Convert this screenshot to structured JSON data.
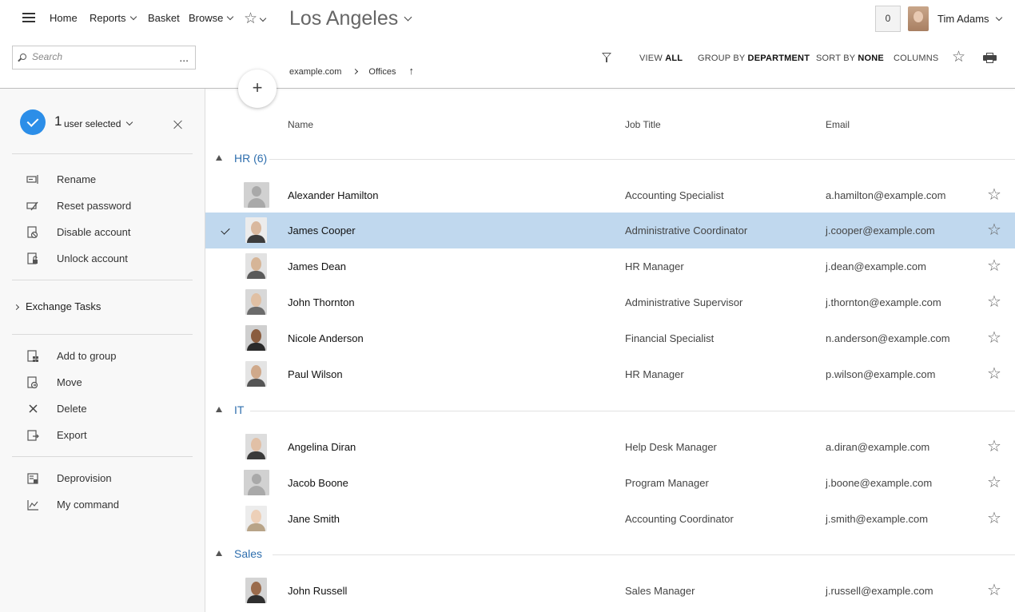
{
  "nav": {
    "items": [
      {
        "label": "Home",
        "has_dropdown": false
      },
      {
        "label": "Reports",
        "has_dropdown": true
      },
      {
        "label": "Basket",
        "has_dropdown": false
      },
      {
        "label": "Browse",
        "has_dropdown": true
      }
    ],
    "favorites_icon": "star-icon",
    "page_title": "Los Angeles",
    "notification_count": "0",
    "user_name": "Tim Adams"
  },
  "search": {
    "placeholder": "Search",
    "more_label": "..."
  },
  "breadcrumb": {
    "items": [
      "example.com",
      "Offices"
    ],
    "up_icon": "↑"
  },
  "toolbar": {
    "view_prefix": "VIEW",
    "view_value": "ALL",
    "group_prefix": "GROUP BY",
    "group_value": "DEPARTMENT",
    "sort_prefix": "SORT BY",
    "sort_value": "NONE",
    "columns_label": "COLUMNS"
  },
  "fab_label": "+",
  "selection": {
    "count": "1",
    "label": "user selected"
  },
  "sidebar": {
    "actions_1": [
      {
        "label": "Rename",
        "icon": "rename-icon"
      },
      {
        "label": "Reset password",
        "icon": "reset-password-icon"
      },
      {
        "label": "Disable account",
        "icon": "disable-account-icon"
      },
      {
        "label": "Unlock account",
        "icon": "unlock-account-icon"
      }
    ],
    "group_label": "Exchange Tasks",
    "actions_2": [
      {
        "label": "Add to group",
        "icon": "add-to-group-icon"
      },
      {
        "label": "Move",
        "icon": "move-icon"
      },
      {
        "label": "Delete",
        "icon": "delete-icon"
      },
      {
        "label": "Export",
        "icon": "export-icon"
      }
    ],
    "actions_3": [
      {
        "label": "Deprovision",
        "icon": "deprovision-icon"
      },
      {
        "label": "My command",
        "icon": "my-command-icon"
      }
    ]
  },
  "columns": {
    "name": "Name",
    "job_title": "Job Title",
    "email": "Email"
  },
  "groups": [
    {
      "name": "HR (6)",
      "rows": [
        {
          "name": "Alexander Hamilton",
          "title": "Accounting Specialist",
          "email": "a.hamilton@example.com",
          "photo": false,
          "selected": false
        },
        {
          "name": "James Cooper",
          "title": "Administrative Coordinator",
          "email": "j.cooper@example.com",
          "photo": true,
          "selected": true
        },
        {
          "name": "James Dean",
          "title": "HR Manager",
          "email": "j.dean@example.com",
          "photo": true,
          "selected": false
        },
        {
          "name": "John Thornton",
          "title": "Administrative Supervisor",
          "email": "j.thornton@example.com",
          "photo": true,
          "selected": false
        },
        {
          "name": "Nicole Anderson",
          "title": "Financial Specialist",
          "email": "n.anderson@example.com",
          "photo": true,
          "selected": false
        },
        {
          "name": "Paul Wilson",
          "title": "HR Manager",
          "email": "p.wilson@example.com",
          "photo": true,
          "selected": false
        }
      ]
    },
    {
      "name": "IT",
      "rows": [
        {
          "name": "Angelina Diran",
          "title": "Help Desk Manager",
          "email": "a.diran@example.com",
          "photo": true,
          "selected": false
        },
        {
          "name": "Jacob Boone",
          "title": "Program Manager",
          "email": "j.boone@example.com",
          "photo": false,
          "selected": false
        },
        {
          "name": "Jane Smith",
          "title": "Accounting Coordinator",
          "email": "j.smith@example.com",
          "photo": true,
          "selected": false
        }
      ]
    },
    {
      "name": "Sales",
      "rows": [
        {
          "name": "John Russell",
          "title": "Sales Manager",
          "email": "j.russell@example.com",
          "photo": true,
          "selected": false
        }
      ]
    }
  ],
  "colors": {
    "accent": "#2c8ee8",
    "group_label": "#2f6fae",
    "selected_row": "#c0d8ee"
  }
}
